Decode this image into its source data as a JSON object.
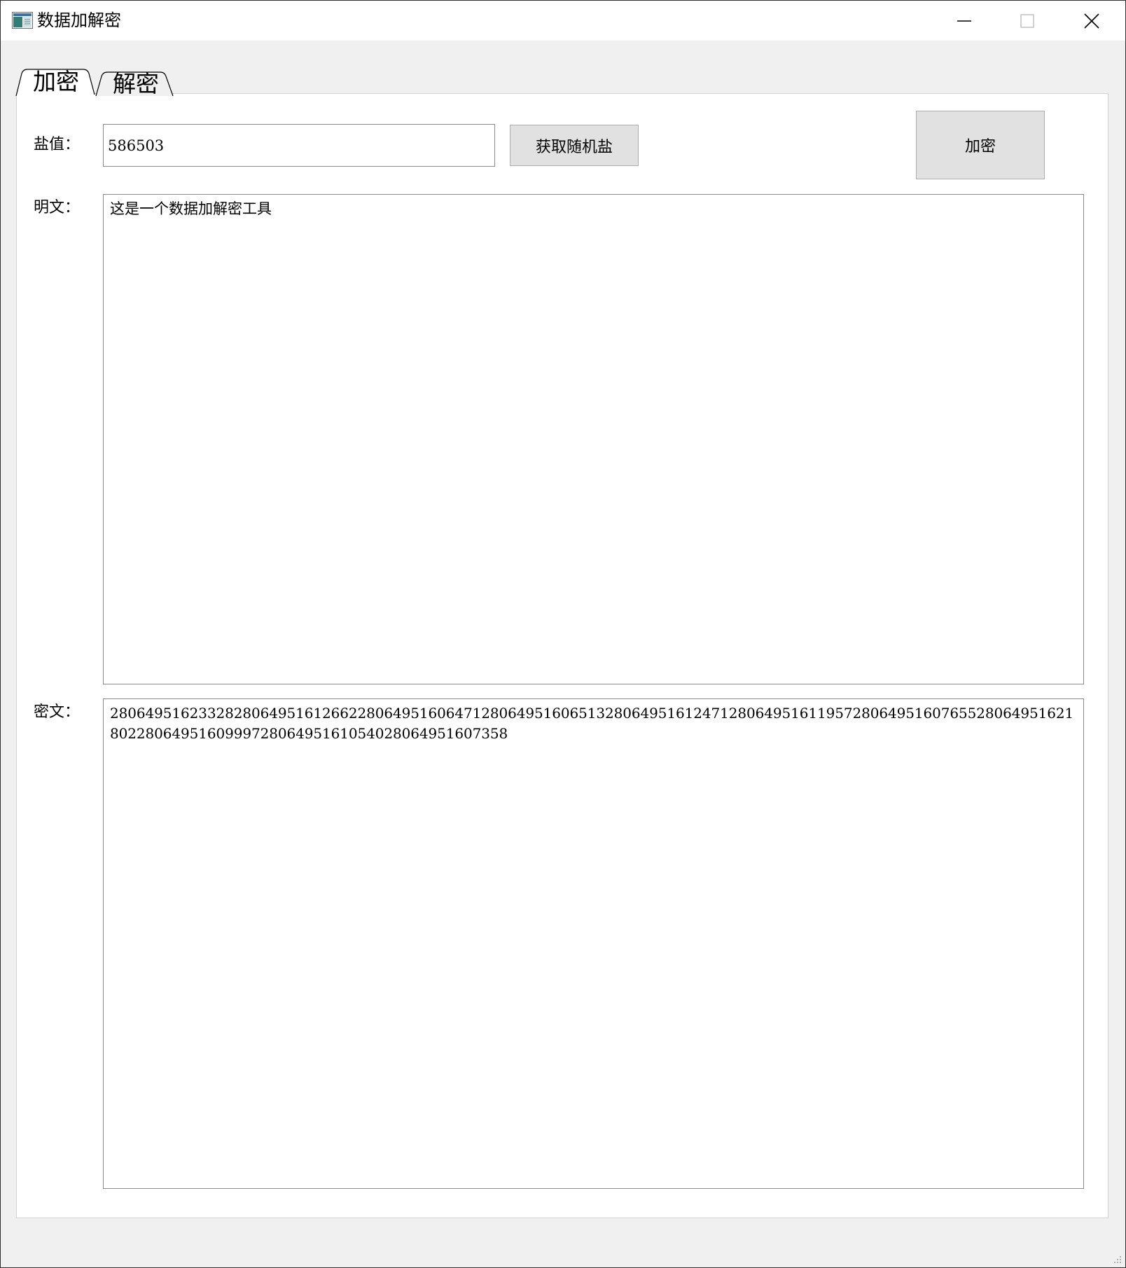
{
  "window": {
    "title": "数据加解密",
    "icon": "app-window-icon"
  },
  "controls": {
    "minimize": "minimize-icon",
    "maximize": "maximize-icon",
    "close": "close-icon"
  },
  "tabs": [
    {
      "label": "加密",
      "selected": true
    },
    {
      "label": "解密",
      "selected": false
    }
  ],
  "encrypt_tab": {
    "salt_label": "盐值：",
    "salt_value": "586503",
    "random_salt_button": "获取随机盐",
    "encrypt_button": "加密",
    "plaintext_label": "明文：",
    "plaintext_value": "这是一个数据加解密工具",
    "ciphertext_label": "密文：",
    "ciphertext_value": "2806495162332828064951612662280649516064712806495160651328064951612471280649516119572806495160765528064951621802280649516099972806495161054028064951607358"
  },
  "colors": {
    "panel_bg": "#ffffff",
    "window_bg": "#f0f0f0",
    "button_bg": "#e1e1e1",
    "border": "#8a8a8a"
  }
}
